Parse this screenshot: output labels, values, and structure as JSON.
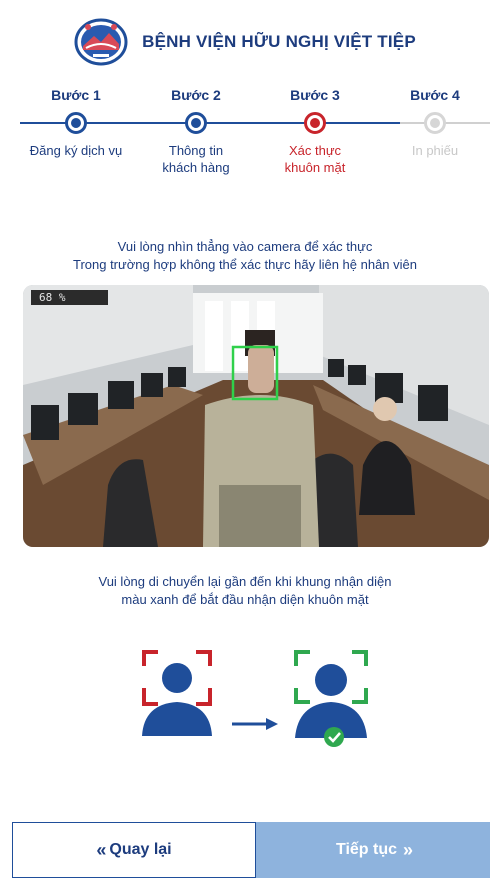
{
  "header": {
    "hospital_name": "BỆNH VIỆN HỮU NGHỊ VIỆT TIỆP"
  },
  "steps": [
    {
      "title": "Bước 1",
      "label_line1": "Đăng ký dịch vụ",
      "label_line2": "",
      "state": "done"
    },
    {
      "title": "Bước 2",
      "label_line1": "Thông tin",
      "label_line2": "khách hàng",
      "state": "done"
    },
    {
      "title": "Bước 3",
      "label_line1": "Xác thực",
      "label_line2": "khuôn mặt",
      "state": "active"
    },
    {
      "title": "Bước 4",
      "label_line1": "In phiếu",
      "label_line2": "",
      "state": "pending"
    }
  ],
  "instructions": {
    "top_line1": "Vui lòng nhìn thẳng vào camera để xác thực",
    "top_line2": "Trong trường hợp không thể xác thực hãy liên hệ nhân viên",
    "bottom_line1": "Vui lòng di chuyển lại gần đến khi khung nhận diện",
    "bottom_line2": "màu xanh để bắt đầu nhận diện khuôn mặt"
  },
  "camera": {
    "confidence": "68 %"
  },
  "buttons": {
    "back_icon": "«",
    "back_label": "Quay lại",
    "next_label": "Tiếp tục",
    "next_icon": "»"
  },
  "colors": {
    "primary": "#1f4e9a",
    "active": "#c8242b",
    "pending": "#d6d6d6",
    "success": "#2fa84f",
    "next_button_disabled": "#8eb3dd"
  }
}
